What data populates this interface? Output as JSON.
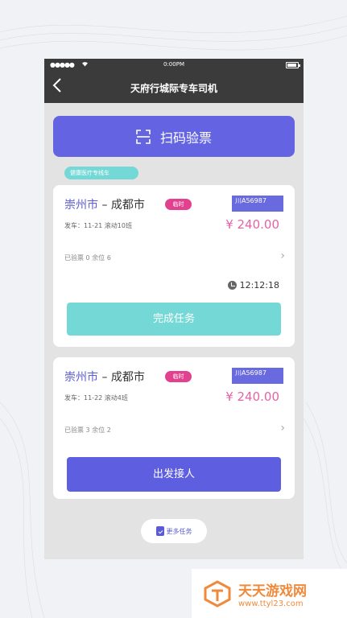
{
  "status_bar": {
    "signal": "●●●●●",
    "wifi": "wifi-icon",
    "time": "0:00PM"
  },
  "header": {
    "back_icon": "chevron-left-icon",
    "title": "天府行城际专车司机"
  },
  "scan_button": {
    "icon": "scan-icon",
    "label": "扫码验票"
  },
  "section_tag": "健康医疗专线车",
  "cards": [
    {
      "from": "崇州市",
      "separator": " – ",
      "to": "成都市",
      "badge": "临时",
      "plate": "川A56987",
      "depart": "发车：11-21 滚动10班",
      "price": "¥ 240.00",
      "checked": "已验票 0  余位 6",
      "chevron": "›",
      "timer": "12:12:18",
      "action": "完成任务"
    },
    {
      "from": "崇州市",
      "separator": " – ",
      "to": "成都市",
      "badge": "临时",
      "plate": "川A56987",
      "depart": "发车：11-22 滚动4班",
      "price": "¥ 240.00",
      "checked": "已验票 3  余位 2",
      "chevron": "›",
      "action": "出发接人"
    }
  ],
  "more_button": {
    "icon": "clipboard-check-icon",
    "label": "更多任务"
  },
  "watermark": {
    "name": "天天游戏网",
    "url": "www.ttyl23.com"
  },
  "colors": {
    "primary": "#6464e2",
    "teal": "#74d9d6",
    "pink": "#e2418f",
    "price": "#e363a6",
    "dark_bar": "#3b3b3b"
  }
}
